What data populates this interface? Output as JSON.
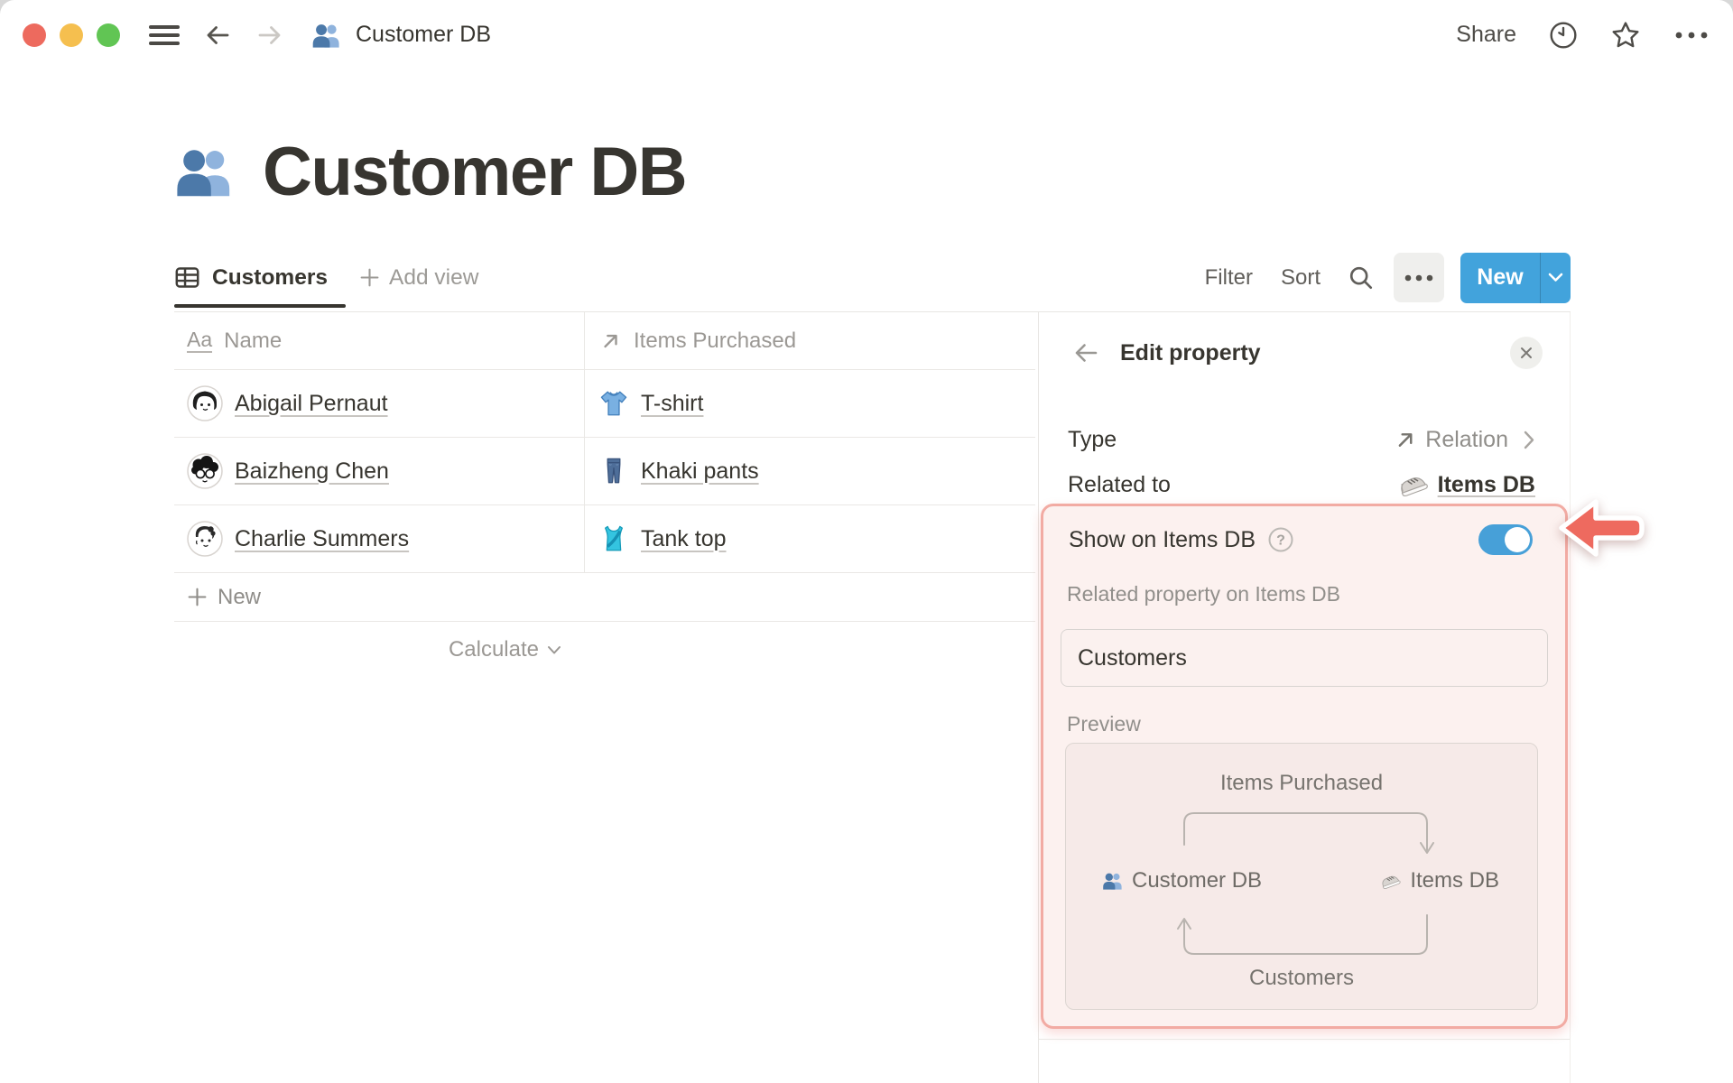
{
  "window": {
    "title": "Customer DB",
    "share": "Share"
  },
  "page": {
    "icon": "busts-in-silhouette",
    "title": "Customer DB"
  },
  "toolbar": {
    "active_view": "Customers",
    "add_view": "Add view",
    "filter": "Filter",
    "sort": "Sort",
    "new_label": "New"
  },
  "table": {
    "columns": [
      {
        "label": "Name",
        "icon": "text-type-icon"
      },
      {
        "label": "Items Purchased",
        "icon": "relation-arrow-icon"
      }
    ],
    "rows": [
      {
        "name": "Abigail Pernaut",
        "item": "T-shirt",
        "item_icon": "tshirt-icon"
      },
      {
        "name": "Baizheng Chen",
        "item": "Khaki pants",
        "item_icon": "jeans-icon"
      },
      {
        "name": "Charlie Summers",
        "item": "Tank top",
        "item_icon": "tank-top-icon"
      }
    ],
    "new_row": "New",
    "calculate": "Calculate"
  },
  "panel": {
    "title": "Edit property",
    "type_label": "Type",
    "type_value": "Relation",
    "related_label": "Related to",
    "related_value": "Items DB",
    "highlight": {
      "show_label": "Show on Items DB",
      "toggle_on": true,
      "related_property_label": "Related property on Items DB",
      "related_property_value": "Customers",
      "preview_label": "Preview",
      "diagram": {
        "top": "Items Purchased",
        "left": "Customer DB",
        "right": "Items DB",
        "bottom": "Customers"
      }
    }
  },
  "colors": {
    "accent_blue": "#42a3dc",
    "toggle_blue": "#47a0d8",
    "highlight_bg": "#fcf1ef",
    "highlight_border": "#f2aba3",
    "arrow_red": "#ee6a5f",
    "text_dark": "#37352f",
    "text_gray": "#9b9894"
  }
}
